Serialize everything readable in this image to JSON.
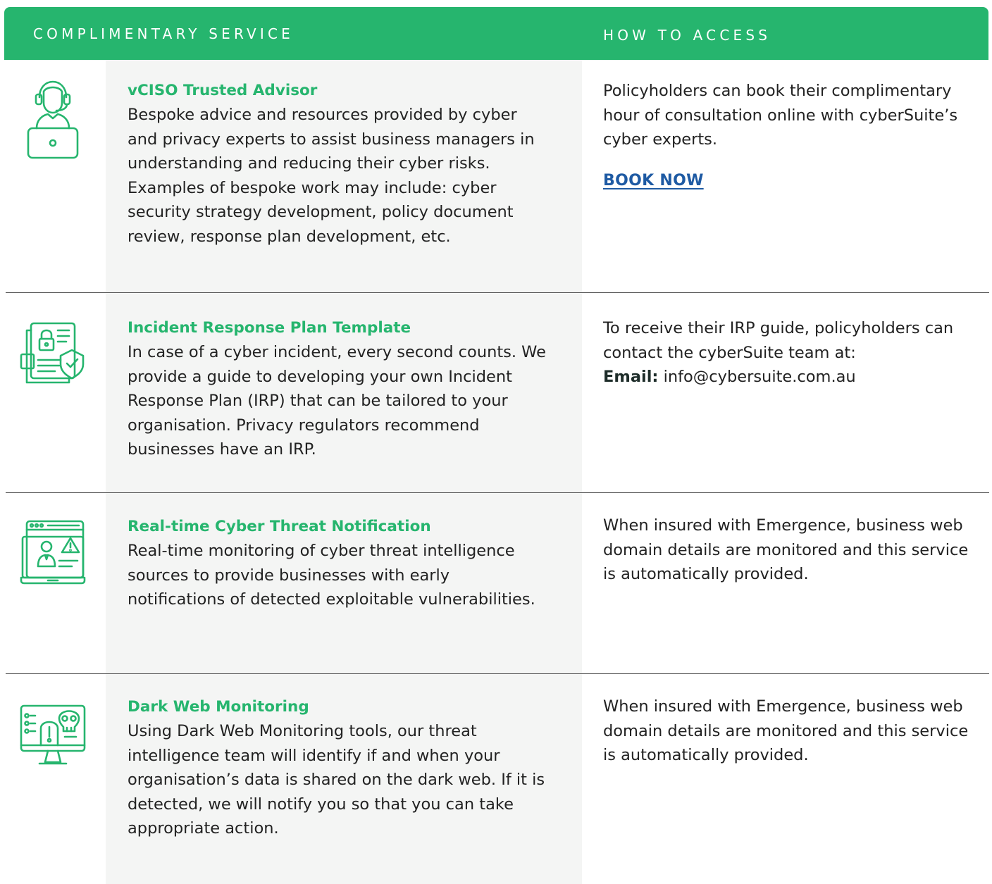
{
  "header": {
    "service_label": "COMPLIMENTARY SERVICE",
    "access_label": "HOW TO ACCESS"
  },
  "colors": {
    "brand_green": "#26b56e",
    "link_blue": "#1e5aa3",
    "panel_grey": "#f4f5f4"
  },
  "services": [
    {
      "icon": "advisor-headset-laptop-icon",
      "title": "vCISO Trusted Advisor",
      "description": "Bespoke advice and resources provided by cyber and privacy experts to assist business managers in understanding and reducing their cyber risks. Examples of bespoke work may include: cyber security strategy development, policy document review, response plan development, etc.",
      "access": "Policyholders can book their complimentary hour of consultation online with cyberSuite’s cyber experts.",
      "link_label": "BOOK NOW"
    },
    {
      "icon": "locked-document-shield-icon",
      "title": "Incident Response Plan Template",
      "description": "In case of a cyber incident, every second counts. We provide a guide to developing your own Incident Response Plan (IRP) that can be tailored to your organisation. Privacy regulators recommend businesses have an IRP.",
      "access": "To receive their IRP guide, policyholders can contact the cyberSuite team at:",
      "email_label": "Email:",
      "email_value": "info@cybersuite.com.au"
    },
    {
      "icon": "threat-alert-laptop-icon",
      "title": "Real-time Cyber Threat Notification",
      "description": "Real-time monitoring of cyber threat intelligence sources to provide businesses with early notifications of detected exploitable vulnerabilities.",
      "access": "When insured with Emergence, business web domain details are monitored and this service is automatically provided."
    },
    {
      "icon": "dark-web-skull-monitor-icon",
      "title": "Dark Web Monitoring",
      "description": "Using Dark Web Monitoring tools, our threat intelligence team will identify if and when your organisation’s data is shared on the dark web. If it is detected, we will notify you so that you can take appropriate action.",
      "access": "When insured with Emergence, business web domain details are monitored and this service is automatically provided."
    }
  ]
}
